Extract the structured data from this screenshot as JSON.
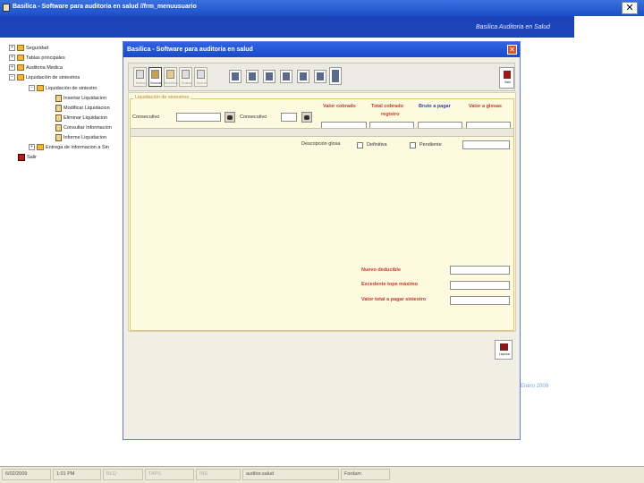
{
  "app": {
    "title": "Basilica - Software para auditoria en salud //frm_menuusuario",
    "close_glyph": "✕",
    "banner_text": "Basilica  Auditoria  en  Salud",
    "footer_text": "Enero 2009"
  },
  "tree": {
    "expander_plus": "+",
    "expander_minus": "−",
    "items": [
      {
        "label": "Seguridad"
      },
      {
        "label": "Tablas principales"
      },
      {
        "label": "Auditoria Medica"
      },
      {
        "label": "Liquidación de siniestros"
      },
      {
        "label": "Liquidación de siniestro"
      },
      {
        "label": "Insertar Liquidacion"
      },
      {
        "label": "Modificar Liquidacion"
      },
      {
        "label": "Eliminar Liquidacion"
      },
      {
        "label": "Consultar Informacion"
      },
      {
        "label": "Informe Liquidacion"
      },
      {
        "label": "Entrega de informacion a Sin"
      },
      {
        "label": "Salir"
      }
    ]
  },
  "dialog": {
    "title": "Basilica - Software para auditoria en salud",
    "close_glyph": "✕",
    "toolbar_buttons": [
      {
        "label": "Nuevo",
        "icon": "new-icon"
      },
      {
        "label": "Buscar",
        "icon": "search-icon"
      },
      {
        "label": "Modificar",
        "icon": "edit-icon"
      },
      {
        "label": "Grabar",
        "icon": "save-icon"
      },
      {
        "label": "Borrar",
        "icon": "delete-icon"
      }
    ],
    "icon_buttons": [
      "calculator-icon",
      "report-icon",
      "sigma-icon",
      "chart-icon",
      "image-icon",
      "print-icon",
      "document-list-icon"
    ],
    "exit_label": "Salir",
    "group_title": "Liquidación de siniestros",
    "fields": {
      "consecutivo_label_1": "Consecutivo",
      "consecutivo_label_2": "Consecutivo",
      "valor_cobrado": "Valor cobrado",
      "total_cobrado_line1": "Total cobrado",
      "total_cobrado_line2": "registro",
      "bruto_pagar": "Bruto a pagar",
      "valor_glosas": "Valor a glosas",
      "descripcion_glosa": "Descripción glosa",
      "chk_definitiva": "Definitiva",
      "chk_pendiente": "Pendiente",
      "nuevo_deducible": "Nuevo deducible",
      "excedente": "Excedente tope máximo",
      "valor_total": "Valor total a pagar siniestro"
    },
    "save_label": "Liquidar"
  },
  "status": {
    "cells": [
      "6/02/2009",
      "1:01 PM",
      "BLQ",
      "TAPS",
      "INS",
      "auditor.salud",
      "Fordam"
    ]
  }
}
